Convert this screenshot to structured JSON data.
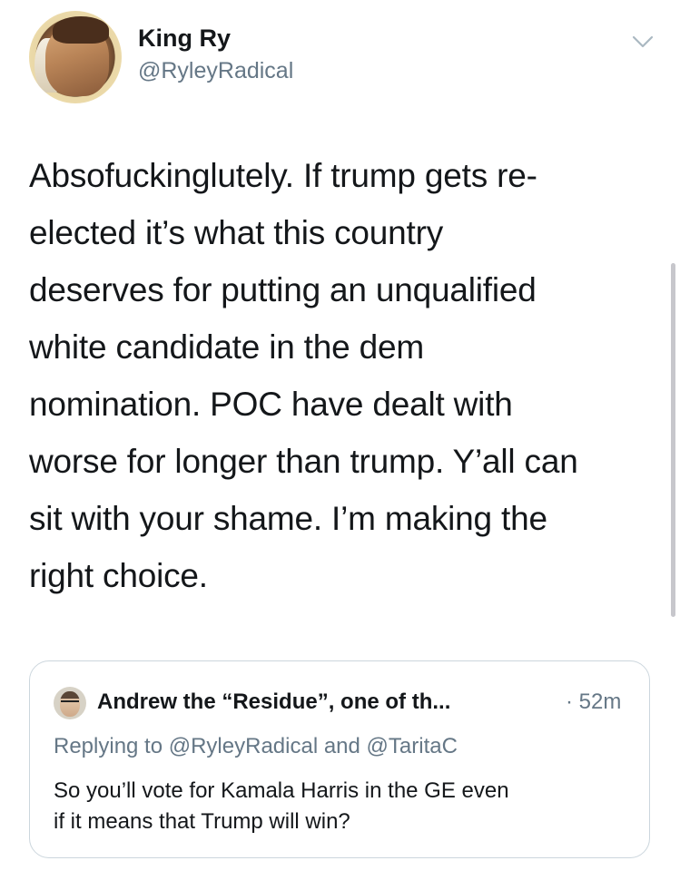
{
  "author": {
    "display_name": "King Ry",
    "handle": "@RyleyRadical",
    "avatar_icon": "profile-photo-avatar"
  },
  "menu_icon": "chevron-down-icon",
  "tweet": {
    "lines": [
      "Absofuckinglutely. If trump gets re-",
      "elected it’s what this country",
      "deserves for putting an unqualified",
      "white candidate in the dem",
      "nomination. POC have dealt with",
      "worse for longer than trump. Y’all can",
      "sit with your shame. I’m making the",
      "right choice."
    ]
  },
  "quoted_tweet": {
    "display_name": "Andrew the “Residue”, one of th...",
    "time": "· 52m",
    "replying_to": "Replying to @RyleyRadical and @TaritaC",
    "lines": [
      "So you’ll vote for Kamala Harris in the GE even",
      "if it means that Trump will win?"
    ]
  },
  "colors": {
    "text_primary": "#14171a",
    "text_secondary": "#657786",
    "border": "#ccd6dd",
    "avatar_ring": "#f3e3b4"
  }
}
